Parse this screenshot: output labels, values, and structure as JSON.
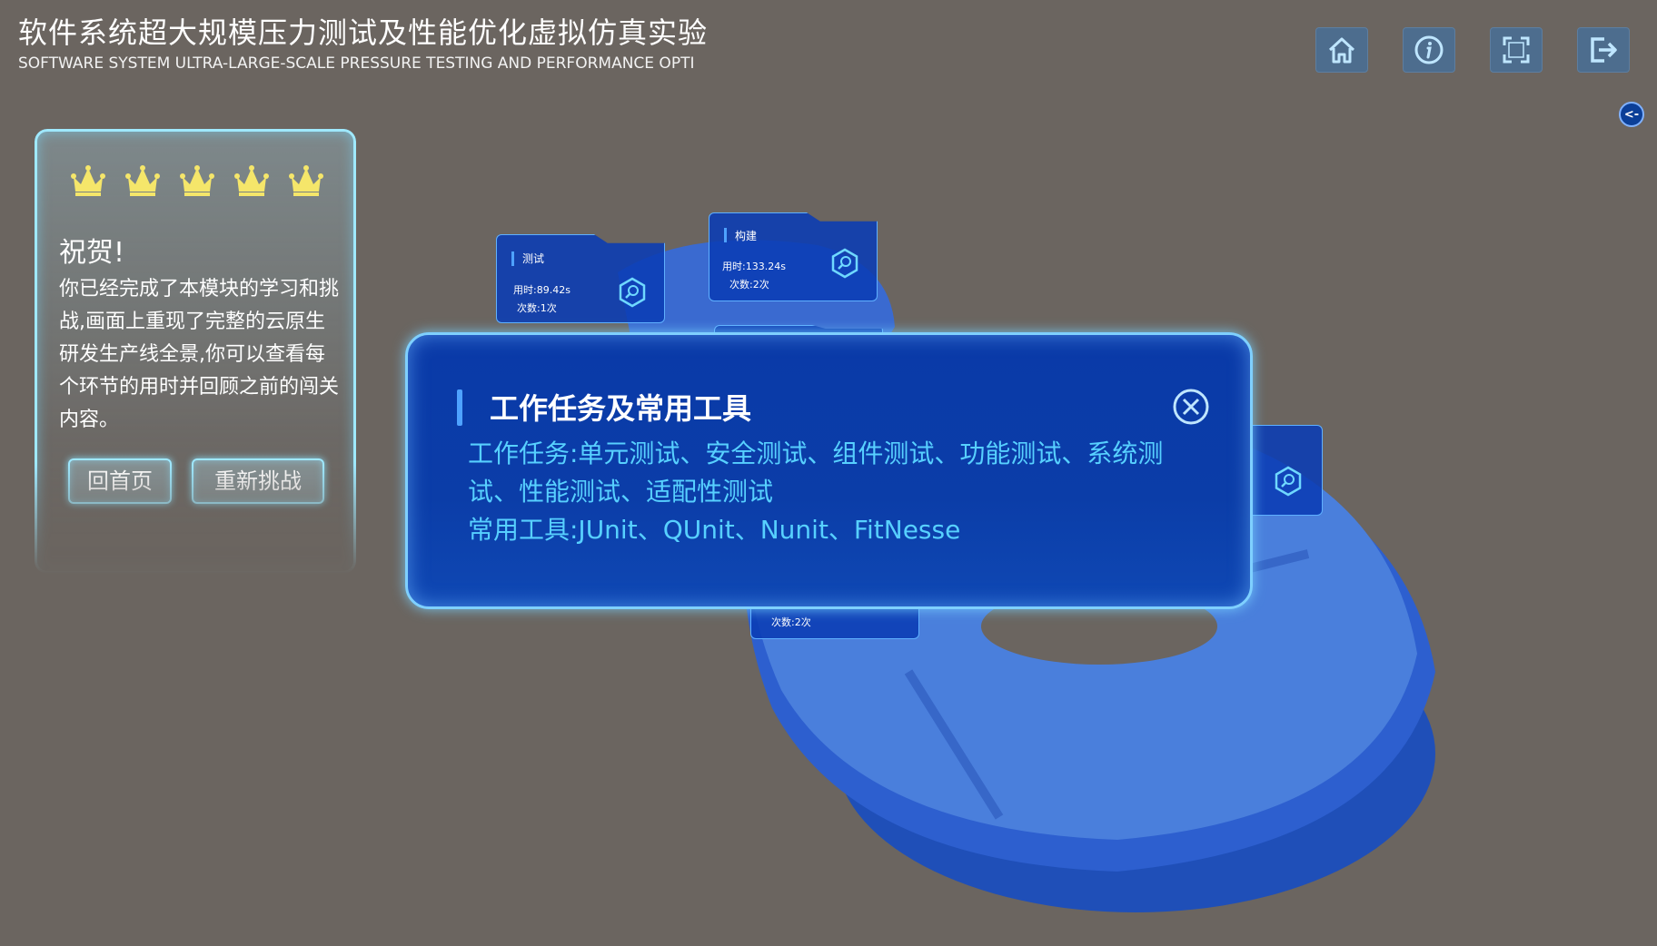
{
  "header": {
    "title_cn": "软件系统超大规模压力测试及性能优化虚拟仿真实验",
    "title_en": "SOFTWARE SYSTEM ULTRA-LARGE-SCALE PRESSURE TESTING AND PERFORMANCE OPTI"
  },
  "toolbar": {
    "items": [
      "home-icon",
      "info-icon",
      "fullscreen-icon",
      "logout-icon"
    ]
  },
  "collapse": {
    "label": "<-"
  },
  "result_panel": {
    "stars_total": 5,
    "stars_earned": 5,
    "heading": "祝贺!",
    "body": "你已经完成了本模块的学习和挑战,画面上重现了完整的云原生研发生产线全景,你可以查看每个环节的用时并回顾之前的闯关内容。",
    "home_button": "回首页",
    "retry_button": "重新挑战"
  },
  "nodes": [
    {
      "name": "测试",
      "time": "用时:89.42s",
      "count": "次数:1次"
    },
    {
      "name": "构建",
      "time": "用时:133.24s",
      "count": "次数:2次"
    },
    {
      "count": "次数:2次"
    }
  ],
  "dialog": {
    "title": "工作任务及常用工具",
    "tasks_line": "工作任务:单元测试、安全测试、组件测试、功能测试、系统测试、性能测试、适配性测试",
    "tools_line": "常用工具:JUnit、QUnit、Nunit、FitNesse"
  },
  "colors": {
    "background": "#6b6560",
    "accent": "#57d0ff",
    "card_blue": "#0a3aa8",
    "crown": "#f5e66a"
  }
}
